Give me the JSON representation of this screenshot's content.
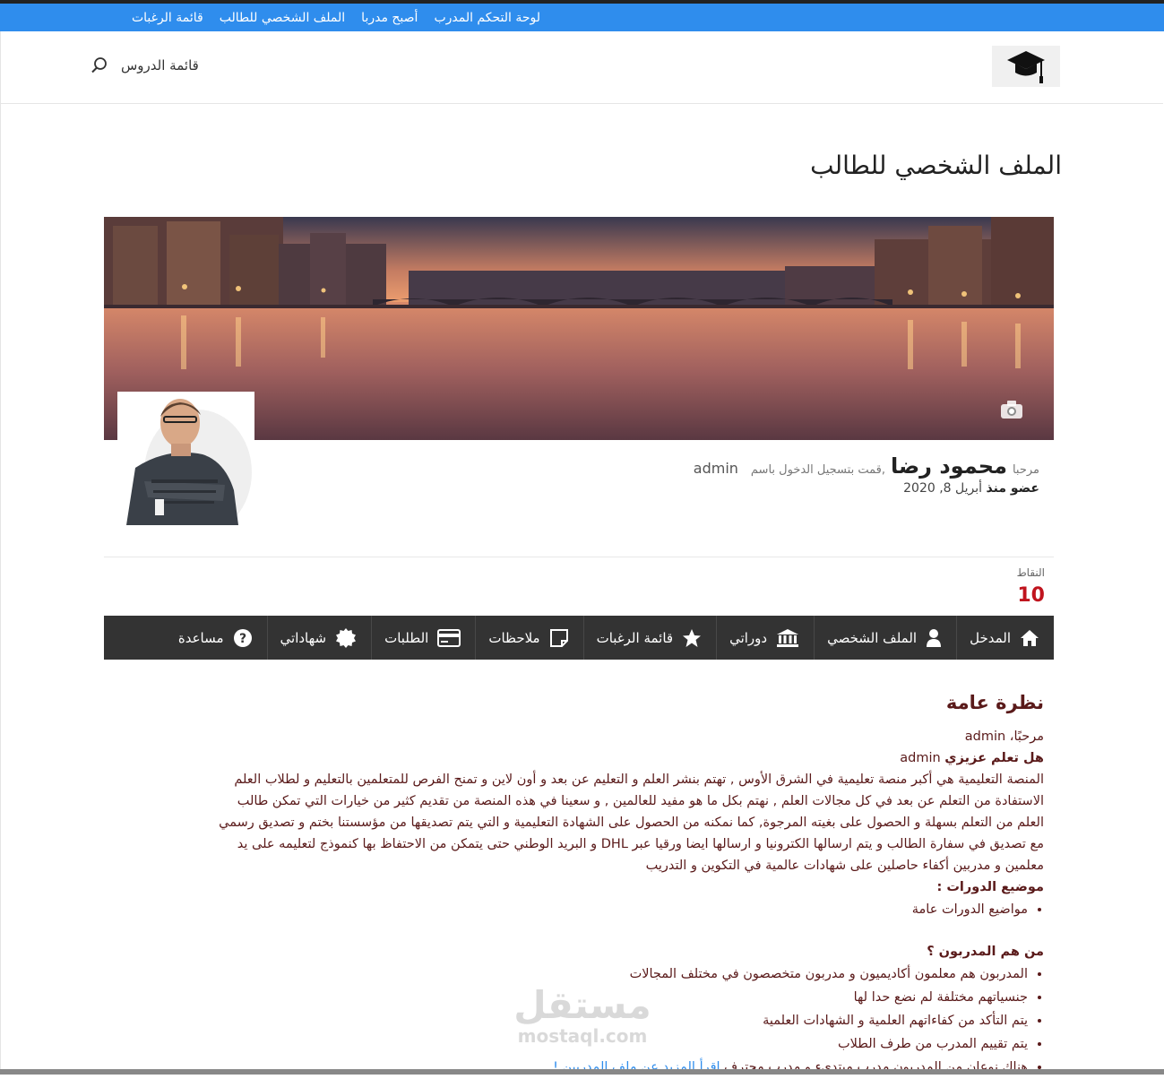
{
  "topbar": {
    "links": [
      "لوحة التحكم المدرب",
      "أصبح مدربا",
      "الملف الشخصي للطالب",
      "قائمة الرغبات"
    ]
  },
  "header": {
    "logo_icon": "graduation-cap-icon",
    "lessons_label": "قائمة الدروس",
    "search_icon": "search-icon"
  },
  "page": {
    "title": "الملف الشخصي للطالب"
  },
  "profile": {
    "hello_small": "مرحبا",
    "name": "محمود رضا",
    "logged_in_as": ",قمت بتسجيل الدخول باسم",
    "username": "admin",
    "member_since_label": "عضو منذ",
    "member_since_value": "أبريل 8, 2020",
    "points_label": "النقاط",
    "points_value": "10"
  },
  "tabs": [
    {
      "label": "المدخل",
      "icon": "home-icon"
    },
    {
      "label": "الملف الشخصي",
      "icon": "user-icon"
    },
    {
      "label": "دوراتي",
      "icon": "bank-icon"
    },
    {
      "label": "قائمة الرغبات",
      "icon": "star-icon"
    },
    {
      "label": "ملاحظات",
      "icon": "note-icon"
    },
    {
      "label": "الطلبات",
      "icon": "credit-card-icon"
    },
    {
      "label": "شهاداتي",
      "icon": "badge-icon"
    },
    {
      "label": "مساعدة",
      "icon": "help-icon"
    }
  ],
  "overview": {
    "heading": "نظرة عامة",
    "greeting": "مرحبًا، admin",
    "did_you_know": "هل تعلم عزيزي",
    "did_you_know_user": "admin",
    "paragraph": [
      "المنصة التعليمية هي أكبر منصة تعليمية في الشرق الأوس , تهتم بنشر العلم و التعليم عن بعد و أون لاين و تمنح الفرص للمتعلمين بالتعليم و لطلاب العلم",
      "الاستفادة من التعلم عن بعد في كل مجالات العلم , نهتم بكل ما هو مفيد للعالمين , و سعينا في هذه المنصة من تقديم كثير من خيارات التي تمكن طالب",
      "العلم من التعلم بسهلة و الحصول على بغيته المرجوة, كما نمكنه من الحصول على الشهادة التعليمية و التي يتم تصديقها من مؤسستنا بختم و تصديق رسمي",
      "مع تصديق في سفارة الطالب و يتم ارسالها الكترونيا و ارسالها ايضا ورقيا عبر DHL و البريد الوطني حتى يتمكن من الاحتفاظ بها كنموذج لتعليمه على يد",
      "معلمين و مدربين أكفاء حاصلين على شهادات عالمية في التكوين و التدريب"
    ],
    "topics_heading": "موضيع الدورات :",
    "topics": [
      "مواضيع الدورات عامة"
    ],
    "trainers_heading": "من هم المدربون ؟",
    "trainers": [
      "المدربون هم معلمون أكاديميون و مدربون متخصصون في مختلف المجالات",
      "جنسياتهم مختلفة لم نضع حدا لها",
      "يتم التأكد من كفاءاتهم العلمية و الشهادات العلمية",
      "يتم تقييم المدرب من طرف الطلاب"
    ],
    "last_item": "هناك نوعان من المدربون مدرب مبتدىء و مدرب محترف",
    "read_more": "إقرأ المزيد عن ملف المدربين !"
  },
  "watermark": {
    "ar": "مستقل",
    "en": "mostaql.com"
  }
}
